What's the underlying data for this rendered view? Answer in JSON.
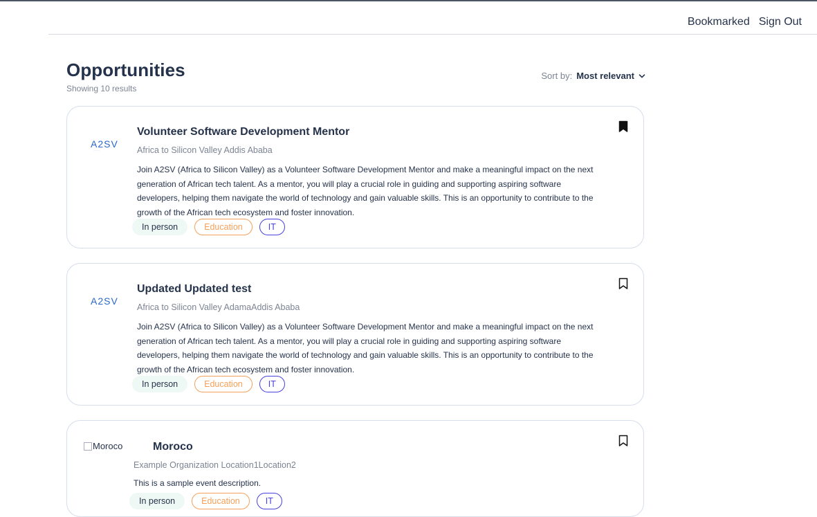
{
  "nav": {
    "bookmarked": "Bookmarked",
    "sign_out": "Sign Out"
  },
  "header": {
    "title": "Opportunities",
    "results": "Showing 10 results",
    "sort_label": "Sort by:",
    "sort_value": "Most relevant"
  },
  "colors": {
    "text_dark": "#25324B",
    "text_muted": "#7C8493",
    "tag_green_bg": "#EEF8F4",
    "tag_orange": "#F5A05A",
    "tag_purple": "#4640DE",
    "card_border": "#D6DDEB"
  },
  "jobs": [
    {
      "logo": "a2sv-logo",
      "logo_text": "A2SV",
      "title": "Volunteer Software Development Mentor",
      "subtitle": "Africa to Silicon Valley Addis Ababa",
      "description": "Join A2SV (Africa to Silicon Valley) as a Volunteer Software Development Mentor and make a meaningful impact on the next generation of African tech talent. As a mentor, you will play a crucial role in guiding and supporting aspiring software developers, helping them navigate the world of technology and gain valuable skills. This is an opportunity to contribute to the growth of the African tech ecosystem and foster innovation.",
      "tags": [
        "In person",
        "Education",
        "IT"
      ],
      "bookmarked": true,
      "bookmark_icon": "bookmark-filled-icon"
    },
    {
      "logo": "a2sv-logo",
      "logo_text": "A2SV",
      "title": "Updated Updated test",
      "subtitle": "Africa to Silicon Valley AdamaAddis Ababa",
      "description": "Join A2SV (Africa to Silicon Valley) as a Volunteer Software Development Mentor and make a meaningful impact on the next generation of African tech talent. As a mentor, you will play a crucial role in guiding and supporting aspiring software developers, helping them navigate the world of technology and gain valuable skills. This is an opportunity to contribute to the growth of the African tech ecosystem and foster innovation.",
      "tags": [
        "In person",
        "Education",
        "IT"
      ],
      "bookmarked": false,
      "bookmark_icon": "bookmark-outline-icon"
    },
    {
      "logo": "broken-image",
      "logo_alt": "Moroco",
      "title": "Moroco",
      "subtitle": "Example Organization Location1Location2",
      "description": "This is a sample event description.",
      "tags": [
        "In person",
        "Education",
        "IT"
      ],
      "bookmarked": false,
      "bookmark_icon": "bookmark-outline-icon"
    }
  ]
}
